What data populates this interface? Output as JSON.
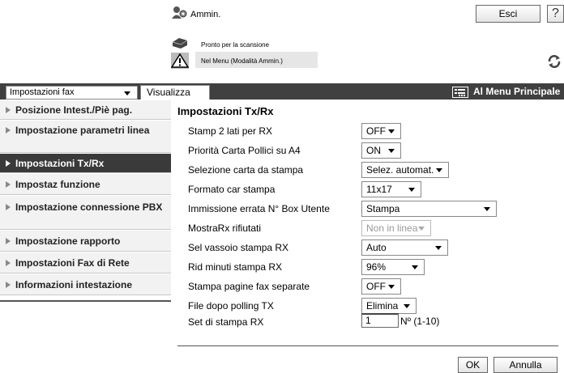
{
  "header": {
    "user_label": "Ammin.",
    "logout_label": "Esci",
    "help_label": "?"
  },
  "status": {
    "scanner": "Pronto per la scansione",
    "mode": "Nel Menu (Modalità Ammin.)"
  },
  "toolbar": {
    "category_select": "Impostazioni fax",
    "view_tab": "Visualizza",
    "main_menu_label": "Al Menu Principale"
  },
  "sidebar": {
    "items": [
      {
        "label": "Posizione Intest./Piè pag."
      },
      {
        "label": "Impostazione parametri linea"
      },
      {
        "label": "Impostazioni Tx/Rx"
      },
      {
        "label": "Impostaz funzione"
      },
      {
        "label": "Impostazione connessione PBX"
      },
      {
        "label": "Impostazione rapporto"
      },
      {
        "label": "Impostazioni Fax di Rete"
      },
      {
        "label": "Informazioni intestazione"
      }
    ]
  },
  "main": {
    "title": "Impostazioni Tx/Rx",
    "rows": [
      {
        "label": "Stamp 2 lati per RX",
        "value": "OFF"
      },
      {
        "label": "Priorità Carta Pollici su A4",
        "value": "ON"
      },
      {
        "label": "Selezione carta da stampa",
        "value": "Selez. automat."
      },
      {
        "label": "Formato car stampa",
        "value": "11x17"
      },
      {
        "label": "Immissione errata N° Box Utente",
        "value": "Stampa"
      },
      {
        "label": "MostraRx rifiutati",
        "value": "Non in linea"
      },
      {
        "label": "Sel vassoio stampa RX",
        "value": "Auto"
      },
      {
        "label": "Rid minuti stampa RX",
        "value": "96%"
      },
      {
        "label": "Stampa pagine fax separate",
        "value": "OFF"
      },
      {
        "label": "File dopo polling TX",
        "value": "Elimina"
      },
      {
        "label": "Set di stampa RX",
        "value": "1",
        "suffix": "Nº (1-10)"
      }
    ],
    "ok_label": "OK",
    "cancel_label": "Annulla"
  }
}
